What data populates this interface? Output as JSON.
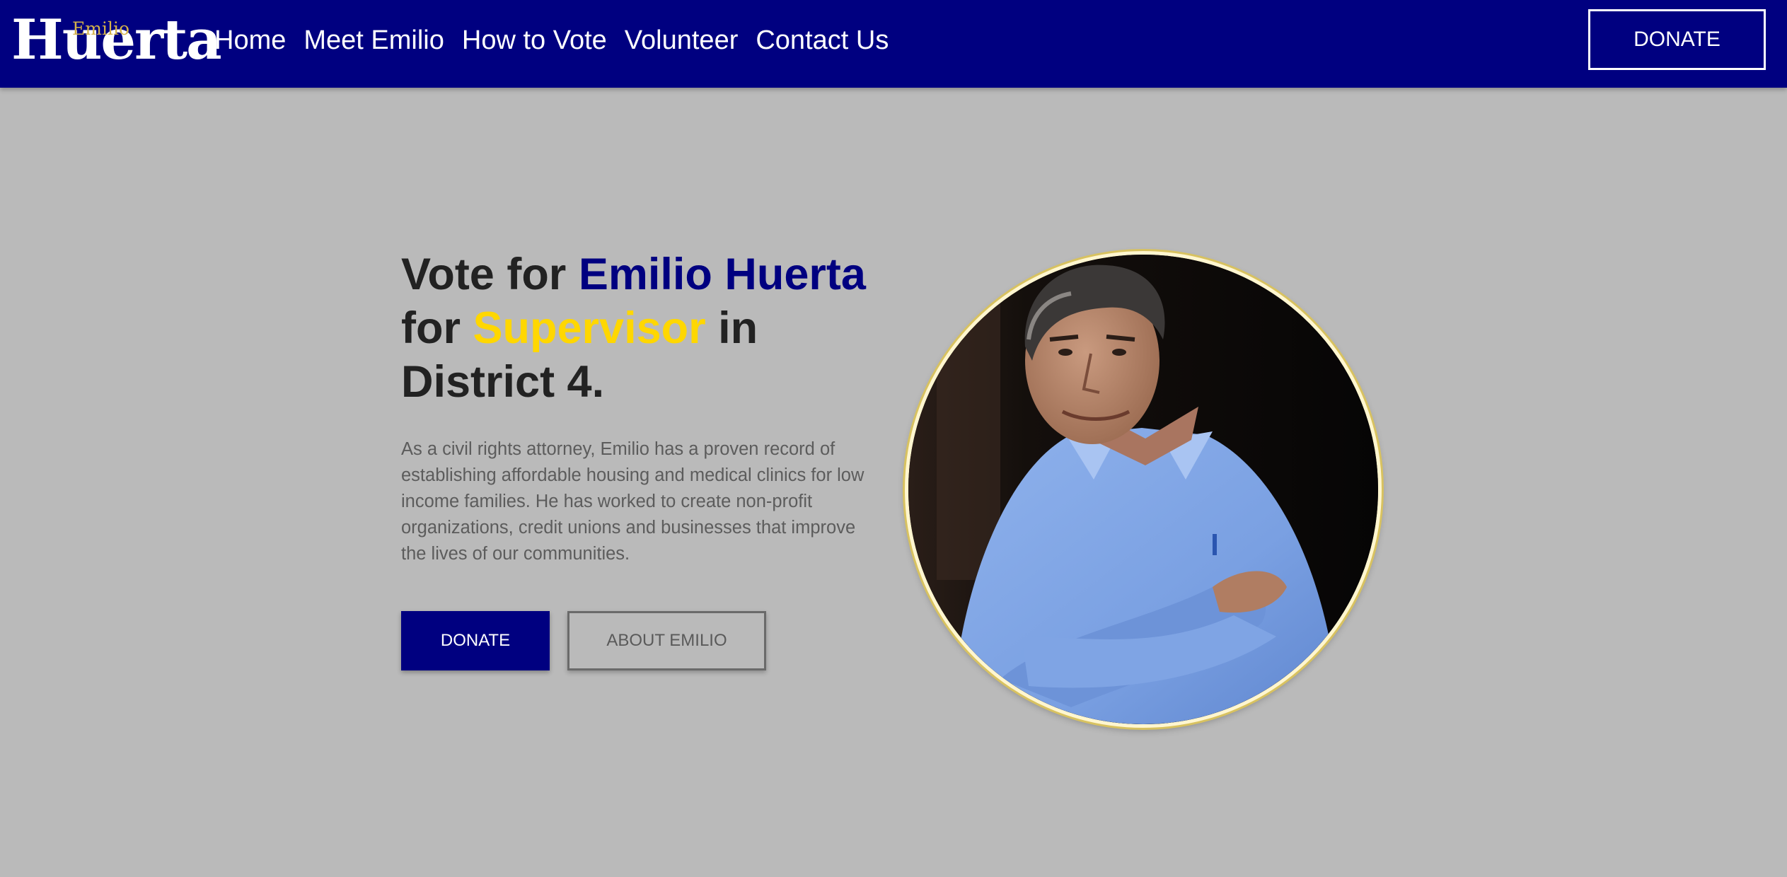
{
  "header": {
    "logo": {
      "small": "Emilio",
      "big": "Huerta"
    },
    "nav": [
      {
        "label": "Home"
      },
      {
        "label": "Meet Emilio"
      },
      {
        "label": "How to Vote"
      },
      {
        "label": "Volunteer"
      },
      {
        "label": "Contact Us"
      }
    ],
    "donate_label": "DONATE"
  },
  "hero": {
    "heading": {
      "part1": "Vote for ",
      "name": "Emilio Huerta",
      "part2": " for ",
      "office": "Supervisor",
      "part3": " in District 4."
    },
    "body": "As a civil rights attorney, Emilio has a proven record of establishing affordable housing and medical clinics for low income families. He has worked to create non-profit organizations, credit unions and businesses that improve the lives of our communities.",
    "donate_label": "DONATE",
    "about_label": "ABOUT EMILIO"
  },
  "colors": {
    "brand_navy": "#000080",
    "accent_gold": "#ffd700",
    "page_background": "#bababa"
  }
}
